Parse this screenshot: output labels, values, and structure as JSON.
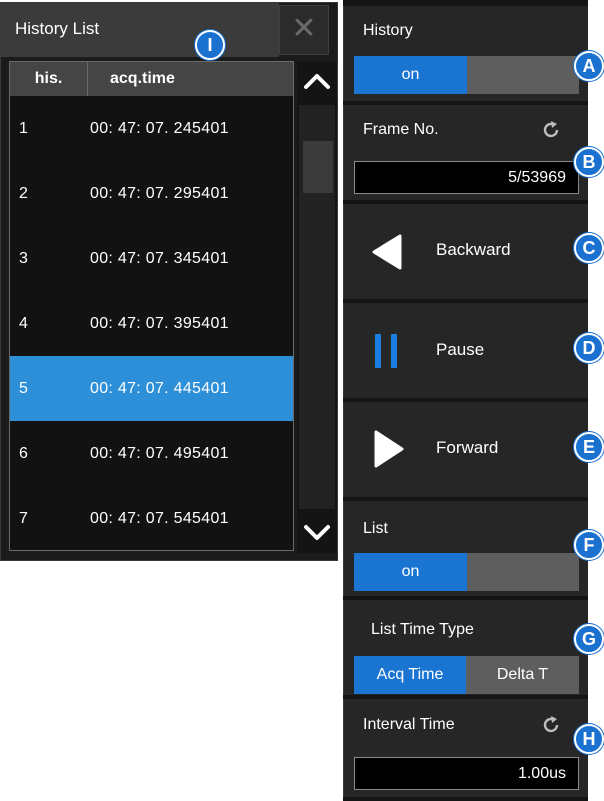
{
  "history_list": {
    "title": "History List",
    "close_glyph": "✕",
    "columns": [
      "his.",
      "acq.time"
    ],
    "rows": [
      {
        "his": "1",
        "time": "00: 47: 07. 245401"
      },
      {
        "his": "2",
        "time": "00: 47: 07. 295401"
      },
      {
        "his": "3",
        "time": "00: 47: 07. 345401"
      },
      {
        "his": "4",
        "time": "00: 47: 07. 395401"
      },
      {
        "his": "5",
        "time": "00: 47: 07. 445401"
      },
      {
        "his": "6",
        "time": "00: 47: 07. 495401"
      },
      {
        "his": "7",
        "time": "00: 47: 07. 545401"
      }
    ],
    "selected_row": "5"
  },
  "panel": {
    "history": {
      "title": "History",
      "state": "on"
    },
    "frame": {
      "title": "Frame No.",
      "value": "5/53969"
    },
    "backward": {
      "label": "Backward"
    },
    "pause": {
      "label": "Pause"
    },
    "forward": {
      "label": "Forward"
    },
    "list": {
      "title": "List",
      "state": "on"
    },
    "list_time_type": {
      "title": "List Time Type",
      "options": [
        "Acq Time",
        "Delta T"
      ],
      "selected": "Acq Time"
    },
    "interval": {
      "title": "Interval Time",
      "value": "1.00us"
    }
  },
  "markers": {
    "a": "A",
    "b": "B",
    "c": "C",
    "d": "D",
    "e": "E",
    "f": "F",
    "g": "G",
    "h": "H",
    "i": "I"
  },
  "colors": {
    "accent": "#1a75d2",
    "selected_row": "#2c8fd8",
    "panel_bg": "#262626",
    "toggle_off": "#5e5e5e"
  }
}
